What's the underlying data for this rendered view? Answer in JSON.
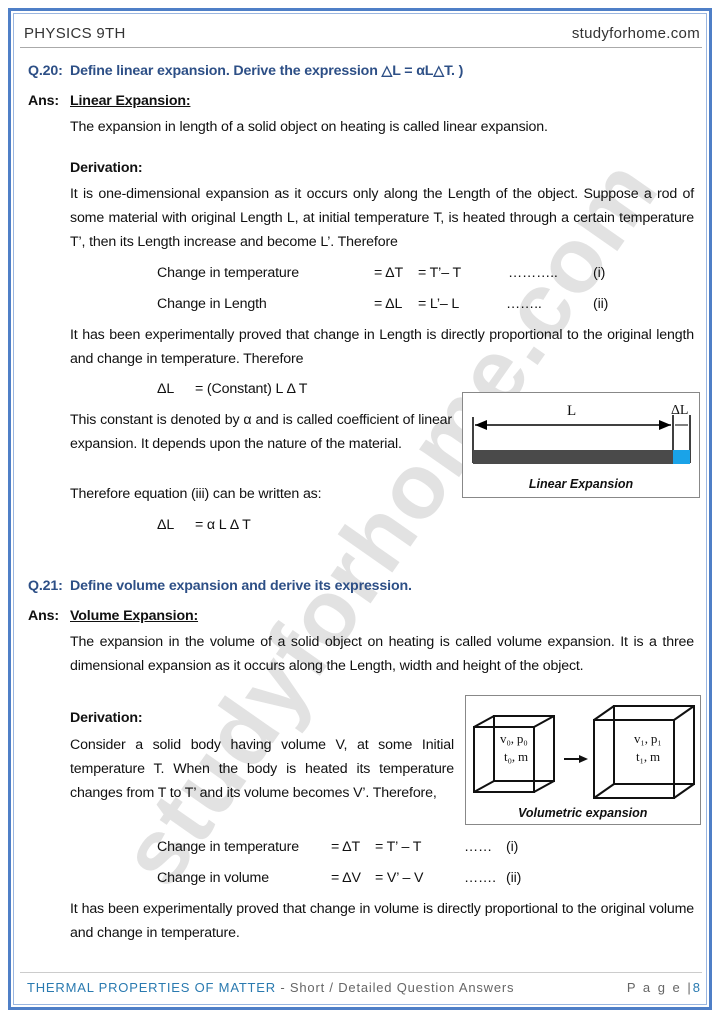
{
  "header": {
    "subject": "PHYSICS 9TH",
    "site": "studyforhome.com"
  },
  "q20": {
    "label": "Q.20:",
    "question": "Define linear expansion. Derive the expression △L = αL△T. )",
    "ans": "Ans:",
    "heading": "Linear Expansion:",
    "definition": "The expansion in length of a solid object on heating is called linear expansion.",
    "derivation": "Derivation:",
    "para1": "It is one-dimensional expansion as it occurs only along the Length of the object. Suppose a rod of some material with original Length L, at initial temperature T, is heated through a certain temperature T’, then its Length increase and become L’. Therefore",
    "rows": [
      {
        "label": "Change in temperature",
        "eq": "= ΔT",
        "val": "= T’– T",
        "dots": "………..",
        "num": "(i)"
      },
      {
        "label": "Change in Length",
        "eq": "= ΔL",
        "val": "= L’– L",
        "dots": "……..",
        "num": "(ii)"
      }
    ],
    "para2": "It has been experimentally proved that change in Length is directly proportional to the original length and change in temperature. Therefore",
    "eq1_lhs": "ΔL",
    "eq1_rhs": "= (Constant) L Δ T",
    "para3": "This constant is denoted by α and is called coefficient of linear expansion. It depends upon the nature of the material.",
    "para4": "Therefore equation (iii) can be written as:",
    "eq2_lhs": "ΔL",
    "eq2_rhs": "= α L Δ T",
    "figure": {
      "label_L": "L",
      "label_dL": "ΔL",
      "caption": "Linear Expansion",
      "rod_color": "#4a4a4a",
      "expansion_color": "#1aa3e8"
    }
  },
  "q21": {
    "label": "Q.21:",
    "question": "Define volume expansion and derive its expression.",
    "ans": "Ans:",
    "heading": "Volume Expansion:",
    "definition": "The expansion in the volume of a solid object on heating is called volume expansion. It is a three dimensional expansion as it occurs along the Length, width and height of the object.",
    "derivation": "Derivation:",
    "para1": "Consider a solid body having volume V, at some Initial temperature T. When the body is heated its temperature changes from T to T’ and its volume becomes V’. Therefore,",
    "rows": [
      {
        "label": "Change in temperature",
        "eq": "= ΔT",
        "val": "= T’ – T",
        "dots": "……",
        "num": "(i)"
      },
      {
        "label": "Change in volume",
        "eq": "= ΔV",
        "val": "= V’ – V",
        "dots": "…….",
        "num": "(ii)"
      }
    ],
    "para2": "It has been experimentally proved that change in volume is directly proportional to the original volume and change in temperature.",
    "figure": {
      "box1_line1": "v₀, p₀",
      "box1_line2": "t₀, m",
      "box2_line1": "v₁, p₁",
      "box2_line2": "t₁, m",
      "caption": "Volumetric expansion"
    }
  },
  "watermark": "studyforhome.com",
  "footer": {
    "chapter": "THERMAL PROPERTIES OF MATTER",
    "subtitle": " - Short / Detailed Question Answers",
    "page_label": "P a g e |",
    "page_number": "8"
  },
  "colors": {
    "accent": "#2d4f86",
    "border": "#4f7fc7"
  }
}
